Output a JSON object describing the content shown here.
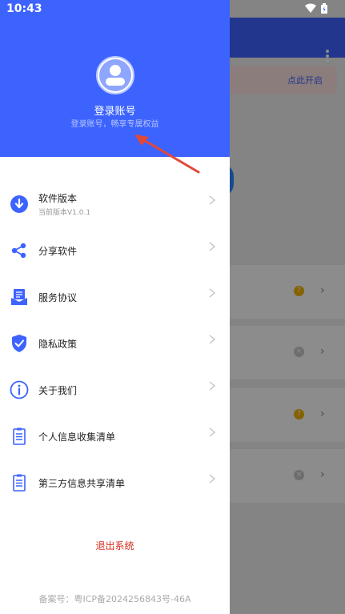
{
  "status_bar": {
    "time": "10:43"
  },
  "background": {
    "banner_text": "点此开启"
  },
  "drawer": {
    "header": {
      "title": "登录账号",
      "subtitle": "登录账号，畅享专属权益"
    },
    "menu": [
      {
        "label": "软件版本",
        "sub": "当前版本V1.0.1",
        "icon": "download-circle-icon"
      },
      {
        "label": "分享软件",
        "sub": "",
        "icon": "share-icon"
      },
      {
        "label": "服务协议",
        "sub": "",
        "icon": "agreement-icon"
      },
      {
        "label": "隐私政策",
        "sub": "",
        "icon": "shield-check-icon"
      },
      {
        "label": "关于我们",
        "sub": "",
        "icon": "info-icon"
      },
      {
        "label": "个人信息收集清单",
        "sub": "",
        "icon": "list-document-icon"
      },
      {
        "label": "第三方信息共享清单",
        "sub": "",
        "icon": "list-document-icon"
      }
    ],
    "logout_label": "退出系统",
    "icp": "备案号：粤ICP备2024256843号-46A"
  },
  "colors": {
    "primary": "#3d63ff",
    "logout": "#d62a1a",
    "arrow": "#e0483a"
  }
}
